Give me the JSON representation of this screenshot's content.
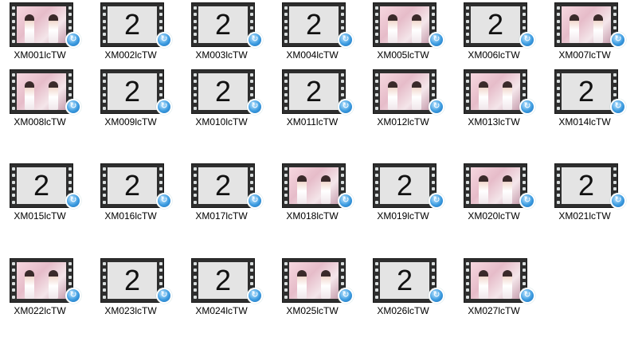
{
  "folder_view": {
    "items": [
      {
        "name": "XM001lcTW",
        "thumb": "photo"
      },
      {
        "name": "XM002lcTW",
        "thumb": "2"
      },
      {
        "name": "XM003lcTW",
        "thumb": "2"
      },
      {
        "name": "XM004lcTW",
        "thumb": "2"
      },
      {
        "name": "XM005lcTW",
        "thumb": "photo"
      },
      {
        "name": "XM006lcTW",
        "thumb": "2"
      },
      {
        "name": "XM007lcTW",
        "thumb": "photo"
      },
      {
        "name": "XM008lcTW",
        "thumb": "photo"
      },
      {
        "name": "XM009lcTW",
        "thumb": "2"
      },
      {
        "name": "XM010lcTW",
        "thumb": "2"
      },
      {
        "name": "XM011lcTW",
        "thumb": "2"
      },
      {
        "name": "XM012lcTW",
        "thumb": "photo"
      },
      {
        "name": "XM013lcTW",
        "thumb": "photo"
      },
      {
        "name": "XM014lcTW",
        "thumb": "2"
      },
      {
        "name": "XM015lcTW",
        "thumb": "2"
      },
      {
        "name": "XM016lcTW",
        "thumb": "2"
      },
      {
        "name": "XM017lcTW",
        "thumb": "2"
      },
      {
        "name": "XM018lcTW",
        "thumb": "photo"
      },
      {
        "name": "XM019lcTW",
        "thumb": "2"
      },
      {
        "name": "XM020lcTW",
        "thumb": "photo"
      },
      {
        "name": "XM021lcTW",
        "thumb": "2"
      },
      {
        "name": "XM022lcTW",
        "thumb": "photo"
      },
      {
        "name": "XM023lcTW",
        "thumb": "2"
      },
      {
        "name": "XM024lcTW",
        "thumb": "2"
      },
      {
        "name": "XM025lcTW",
        "thumb": "photo"
      },
      {
        "name": "XM026lcTW",
        "thumb": "2"
      },
      {
        "name": "XM027lcTW",
        "thumb": "photo"
      }
    ],
    "icon": "video-file-icon",
    "badge_icon": "media-player-badge-icon",
    "colors": {
      "film_strip": "#2e2e2e",
      "placeholder_frame": "#e4e4e4",
      "badge": "#3b9be0"
    }
  }
}
